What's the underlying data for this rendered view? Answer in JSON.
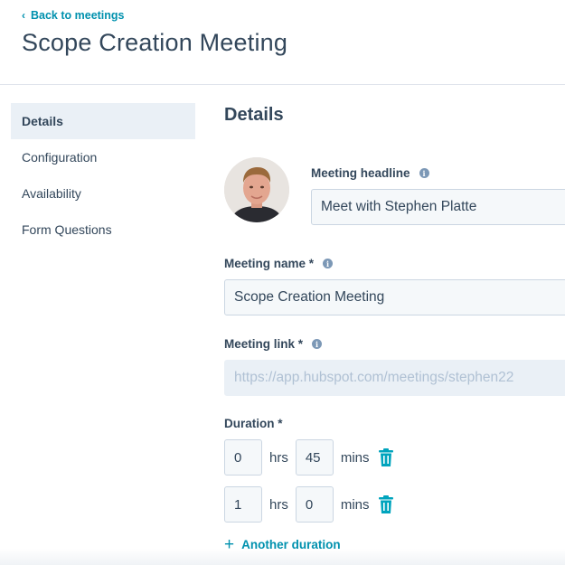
{
  "header": {
    "back_label": "Back to meetings",
    "title": "Scope Creation Meeting"
  },
  "sidebar": {
    "items": [
      {
        "label": "Details",
        "active": true
      },
      {
        "label": "Configuration",
        "active": false
      },
      {
        "label": "Availability",
        "active": false
      },
      {
        "label": "Form Questions",
        "active": false
      }
    ]
  },
  "details": {
    "section_title": "Details",
    "headline": {
      "label": "Meeting headline",
      "value": "Meet with Stephen Platte"
    },
    "name": {
      "label": "Meeting name *",
      "value": "Scope Creation Meeting"
    },
    "link": {
      "label": "Meeting link *",
      "value": "https://app.hubspot.com/meetings/stephen22"
    },
    "duration": {
      "label": "Duration *",
      "rows": [
        {
          "hrs": "0",
          "mins": "45"
        },
        {
          "hrs": "1",
          "mins": "0"
        }
      ],
      "hrs_unit": "hrs",
      "mins_unit": "mins",
      "add_label": "Another duration"
    }
  },
  "colors": {
    "accent": "#0091ae",
    "text": "#33475b",
    "input_bg": "#f5f8fa",
    "input_border": "#cbd6e2",
    "active_nav_bg": "#eaf0f6"
  }
}
